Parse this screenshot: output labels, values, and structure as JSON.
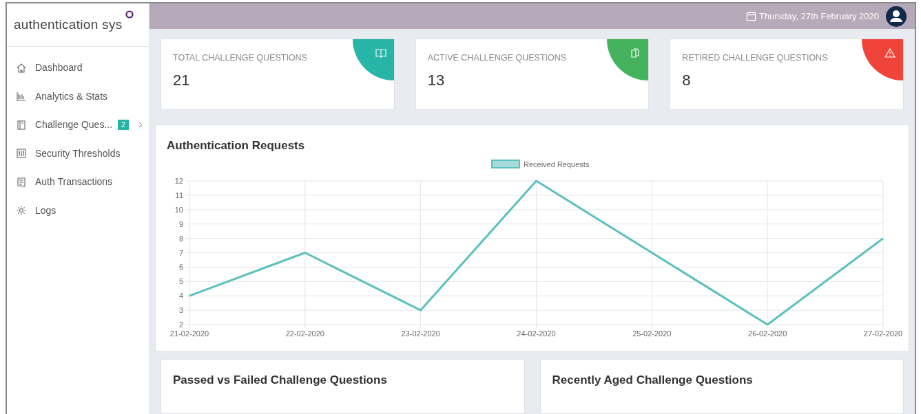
{
  "brand": {
    "name": "authentication sys"
  },
  "sidebar": {
    "items": [
      {
        "label": "Dashboard",
        "expandable": false
      },
      {
        "label": "Analytics & Stats",
        "expandable": false
      },
      {
        "label": "Challenge Ques...",
        "badge": "2",
        "expandable": true
      },
      {
        "label": "Security Thresholds",
        "expandable": false
      },
      {
        "label": "Auth Transactions",
        "expandable": false
      },
      {
        "label": "Logs",
        "expandable": false
      }
    ]
  },
  "header": {
    "date": "Thursday, 27th February 2020"
  },
  "stats": [
    {
      "label": "TOTAL CHALLENGE QUESTIONS",
      "value": "21",
      "color": "#26b5a6"
    },
    {
      "label": "ACTIVE CHALLENGE QUESTIONS",
      "value": "13",
      "color": "#45b35e"
    },
    {
      "label": "RETIRED CHALLENGE QUESTIONS",
      "value": "8",
      "color": "#f0443a"
    }
  ],
  "auth_requests": {
    "title": "Authentication Requests",
    "chart_data": {
      "type": "line",
      "categories": [
        "21-02-2020",
        "22-02-2020",
        "23-02-2020",
        "24-02-2020",
        "25-02-2020",
        "26-02-2020",
        "27-02-2020"
      ],
      "series": [
        {
          "name": "Received Requests",
          "color": "#5bc0be",
          "values": [
            4,
            7,
            3,
            12,
            7,
            2,
            8
          ]
        }
      ],
      "ylim": [
        2,
        12
      ],
      "grid": true,
      "yticks": [
        2,
        3,
        4,
        5,
        6,
        7,
        8,
        9,
        10,
        11,
        12
      ]
    }
  },
  "panels": [
    {
      "title": "Passed vs Failed Challenge Questions"
    },
    {
      "title": "Recently Aged Challenge Questions"
    }
  ]
}
